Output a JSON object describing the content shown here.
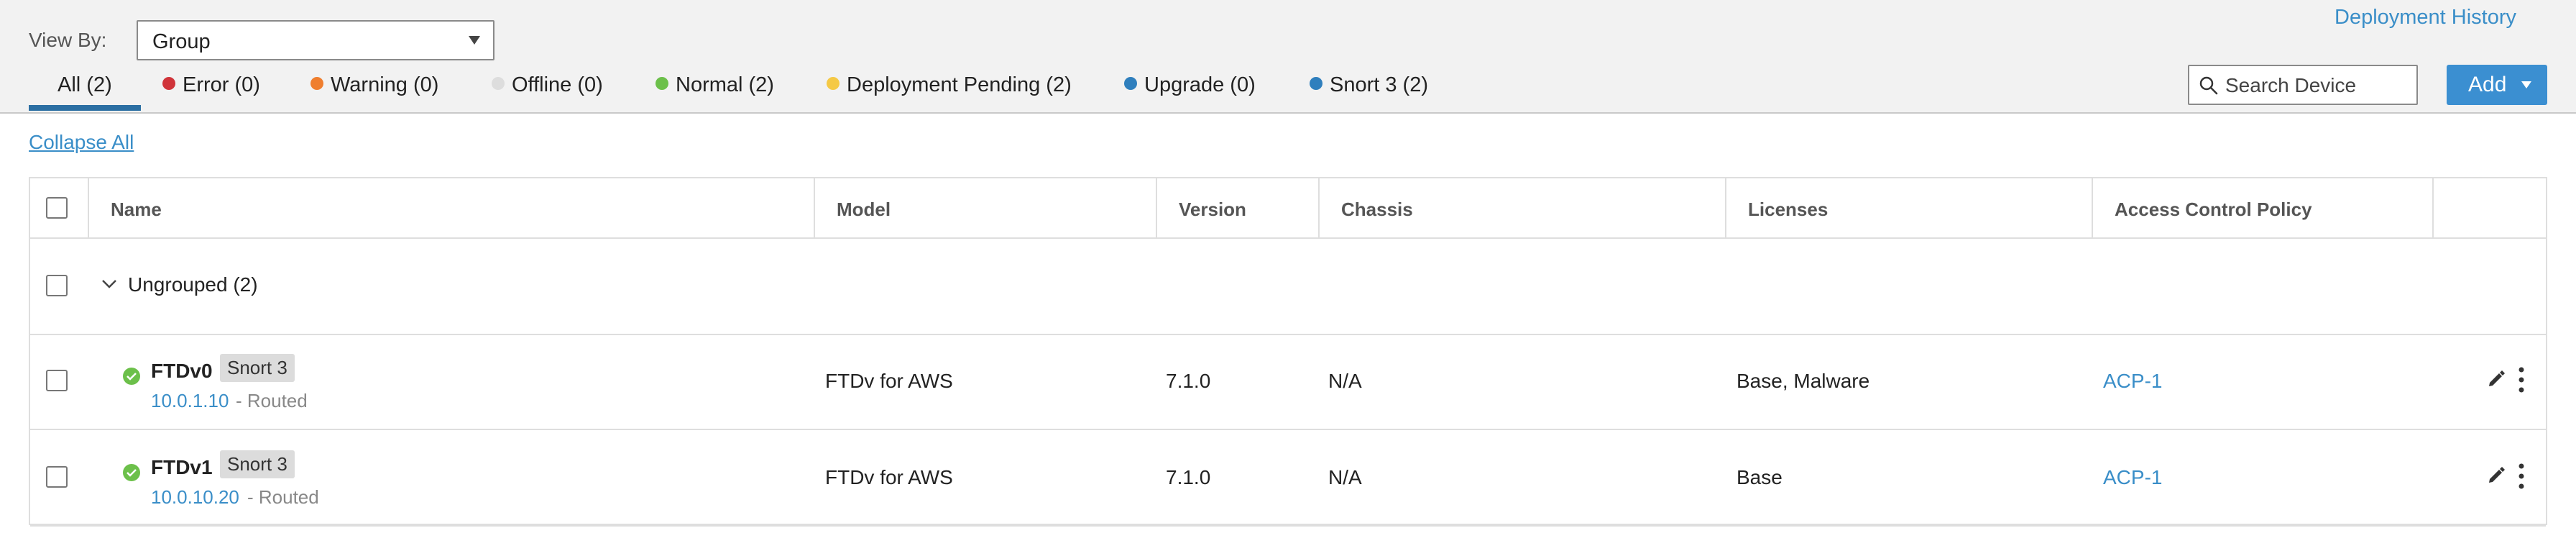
{
  "header": {
    "view_by_label": "View By:",
    "view_by_value": "Group",
    "deployment_history": "Deployment History",
    "search_placeholder": "Search Device",
    "add_label": "Add"
  },
  "tabs": [
    {
      "label": "All (2)",
      "dot_color": null,
      "active": true
    },
    {
      "label": "Error (0)",
      "dot_color": "#d0343a",
      "active": false
    },
    {
      "label": "Warning (0)",
      "dot_color": "#ef7e2e",
      "active": false
    },
    {
      "label": "Offline (0)",
      "dot_color": "#dddddd",
      "active": false
    },
    {
      "label": "Normal (2)",
      "dot_color": "#6cc04a",
      "active": false
    },
    {
      "label": "Deployment Pending (2)",
      "dot_color": "#f5c945",
      "active": false
    },
    {
      "label": "Upgrade (0)",
      "dot_color": "#2f7fbd",
      "active": false
    },
    {
      "label": "Snort 3 (2)",
      "dot_color": "#2f7fbd",
      "active": false
    }
  ],
  "collapse_all": "Collapse All",
  "table": {
    "columns": [
      "Name",
      "Model",
      "Version",
      "Chassis",
      "Licenses",
      "Access Control Policy"
    ],
    "group": {
      "label": "Ungrouped (2)"
    },
    "rows": [
      {
        "name": "FTDv0",
        "badge": "Snort 3",
        "ip": "10.0.1.10",
        "mode": " - Routed",
        "model": "FTDv for AWS",
        "version": "7.1.0",
        "chassis": "N/A",
        "licenses": "Base, Malware",
        "acp": "ACP-1"
      },
      {
        "name": "FTDv1",
        "badge": "Snort 3",
        "ip": "10.0.10.20",
        "mode": " - Routed",
        "model": "FTDv for AWS",
        "version": "7.1.0",
        "chassis": "N/A",
        "licenses": "Base",
        "acp": "ACP-1"
      }
    ]
  },
  "colors": {
    "accent": "#3b8fd1",
    "link": "#3a8ec8",
    "status_normal": "#6cc04a"
  },
  "icons": {
    "search": "search-icon",
    "edit": "pencil-icon",
    "more": "kebab-menu-icon",
    "chevron": "chevron-down-icon",
    "status": "check-circle-icon"
  }
}
